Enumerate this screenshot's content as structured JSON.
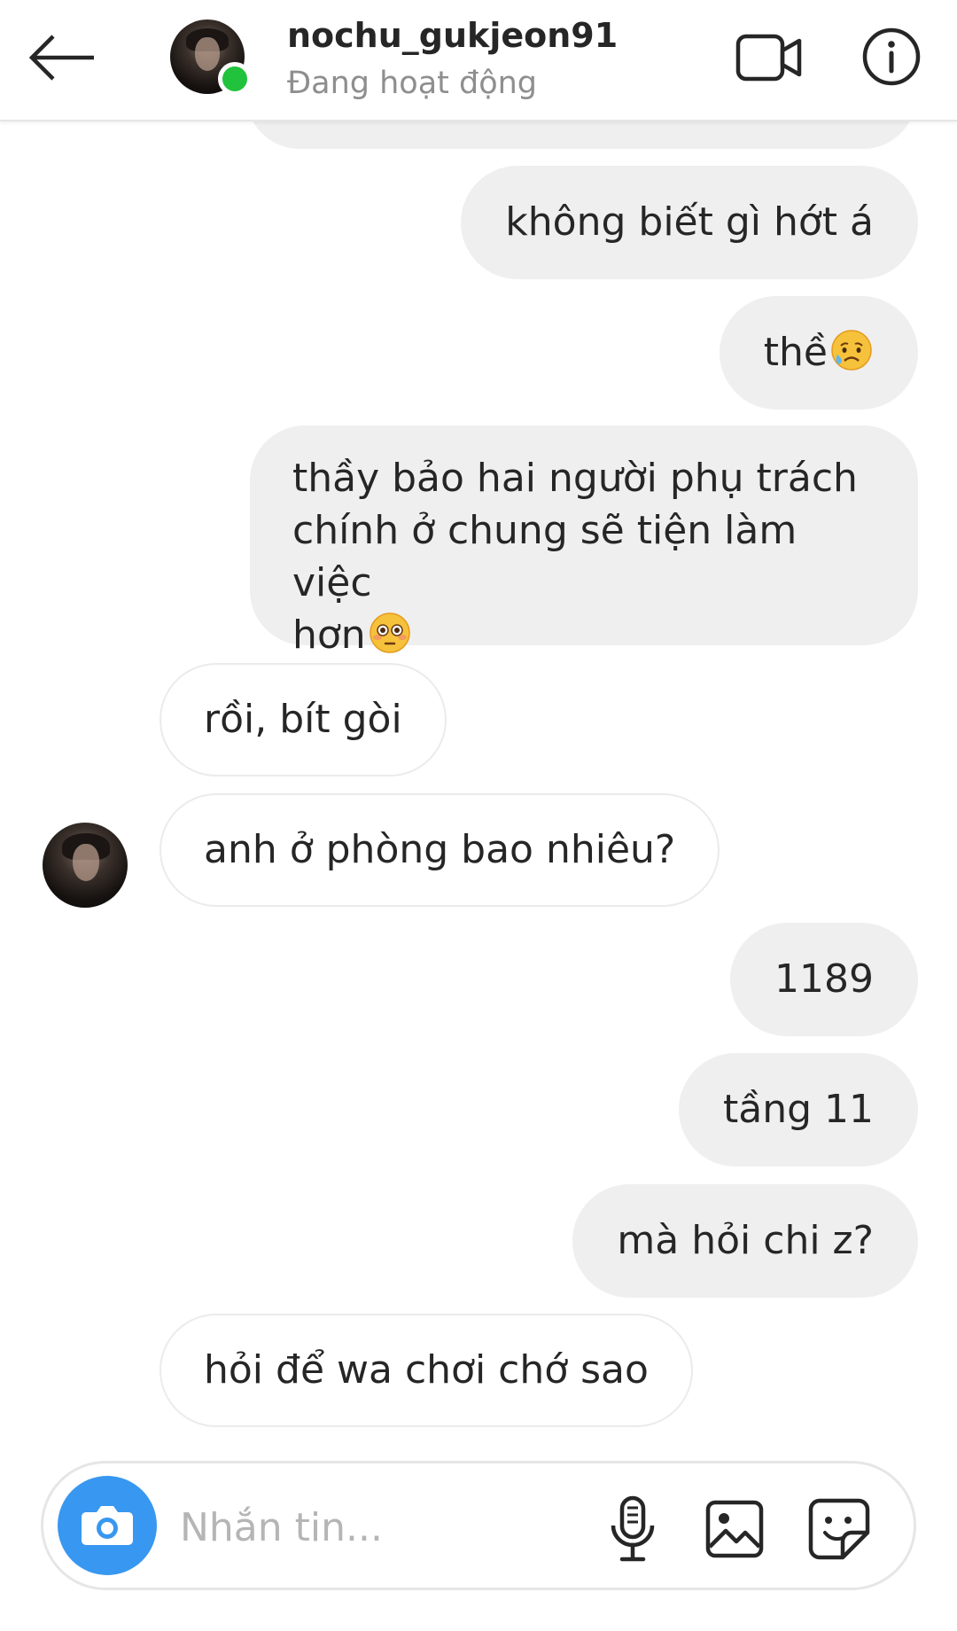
{
  "header": {
    "username": "nochu_gukjeon91",
    "status": "Đang hoạt động",
    "icons": {
      "back": "arrow-left-icon",
      "video": "video-camera-icon",
      "info": "info-icon"
    }
  },
  "messages": [
    {
      "side": "sent",
      "text": "không biết gì hớt á"
    },
    {
      "side": "sent",
      "text": "thề",
      "emoji": "sad-relieved-face"
    },
    {
      "side": "sent",
      "lines": [
        "thầy bảo hai người phụ trách",
        "chính ở chung sẽ tiện làm việc",
        "hơn"
      ],
      "emoji": "flushed-face"
    },
    {
      "side": "received",
      "text": "rồi, bít gòi"
    },
    {
      "side": "received",
      "text": "anh ở phòng bao nhiêu?"
    },
    {
      "side": "sent",
      "text": "1189"
    },
    {
      "side": "sent",
      "text": "tầng 11"
    },
    {
      "side": "sent",
      "text": "mà hỏi chi z?"
    },
    {
      "side": "received",
      "text": "hỏi để wa chơi chớ sao"
    }
  ],
  "composer": {
    "placeholder": "Nhắn tin...",
    "value": "",
    "icons": {
      "camera": "camera-icon",
      "mic": "microphone-icon",
      "gallery": "gallery-icon",
      "sticker": "sticker-icon"
    }
  },
  "colors": {
    "sent_bubble": "#efefef",
    "received_border": "#ebebeb",
    "camera_button": "#3897f0",
    "online_dot": "#20c33b",
    "status_text": "#8e8e8e"
  }
}
